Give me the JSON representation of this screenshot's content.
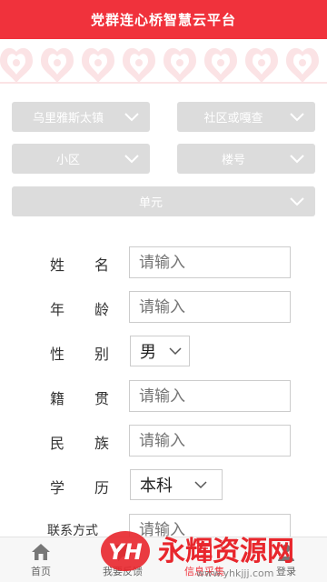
{
  "header": {
    "title": "党群连心桥智慧云平台"
  },
  "filters": {
    "town": {
      "label": "乌里雅斯太镇"
    },
    "community": {
      "label": "社区或嘎查"
    },
    "estate": {
      "label": "小区"
    },
    "building": {
      "label": "楼号"
    },
    "unit": {
      "label": "单元"
    }
  },
  "form": {
    "name": {
      "label": [
        "姓",
        "名"
      ],
      "placeholder": "请输入"
    },
    "age": {
      "label": [
        "年",
        "龄"
      ],
      "placeholder": "请输入"
    },
    "gender": {
      "label": [
        "性",
        "别"
      ],
      "value": "男"
    },
    "origin": {
      "label": [
        "籍",
        "贯"
      ],
      "placeholder": "请输入"
    },
    "ethnicity": {
      "label": [
        "民",
        "族"
      ],
      "placeholder": "请输入"
    },
    "education": {
      "label": [
        "学",
        "历"
      ],
      "value": "本科"
    },
    "contact": {
      "label": "联系方式",
      "placeholder": "请输入"
    }
  },
  "tabs": [
    {
      "label": "首页",
      "icon": "home-icon"
    },
    {
      "label": "我要反馈",
      "icon": "feedback-icon"
    },
    {
      "label": "信息采集",
      "icon": "collect-icon"
    },
    {
      "label": "登录",
      "icon": "login-icon"
    }
  ],
  "watermark": {
    "mark": "YH",
    "text": "永辉资源网",
    "url": "www.yhkjjj.com"
  },
  "colors": {
    "primary": "#f0323c",
    "select_bg": "#dcdcdc"
  }
}
